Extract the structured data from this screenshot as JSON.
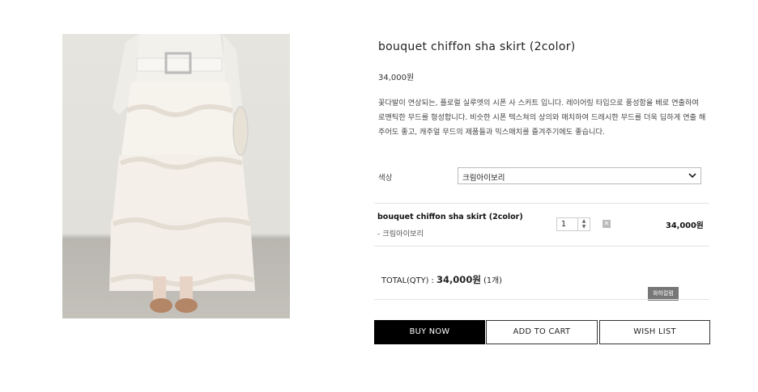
{
  "product": {
    "image_alt": "model wearing white ruffled chiffon maxi skirt",
    "title": "bouquet chiffon sha skirt (2color)",
    "price": "34,000원",
    "description": "꽃다발이 연상되는, 플로럴 실루엣의 시폰 사 스커트 입니다. 레이어링 타입으로 풍성함을 배로 연출하여 로맨틱한 무드를 형성합니다. 비슷한 시폰 텍스쳐의 상의와 매치하여 드레시한 무드를 더욱 딥하게 연출 해 주어도 좋고, 캐주얼 무드의 제품들과 믹스매치를 즐겨주기에도 좋습니다."
  },
  "options": {
    "color_label": "색상",
    "color_selected": "크림아이보리"
  },
  "selected_item": {
    "name": "bouquet chiffon sha skirt (2color)",
    "option": "- 크림아이보리",
    "quantity": "1",
    "price": "34,000원"
  },
  "total": {
    "label": "TOTAL(QTY) : ",
    "amount": "34,000원",
    "count": " (1개)"
  },
  "badge": "와하칼럼",
  "buttons": {
    "buy_now": "BUY NOW",
    "add_to_cart": "ADD TO CART",
    "wish_list": "WISH LIST"
  },
  "colors": {
    "primary_button_bg": "#000000",
    "border": "#333333",
    "badge_bg": "#777777"
  }
}
